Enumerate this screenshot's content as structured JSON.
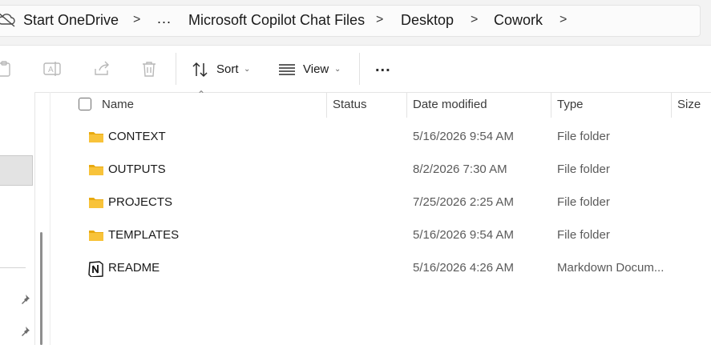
{
  "breadcrumb": {
    "items": [
      "Start OneDrive",
      "...",
      "Microsoft Copilot Chat Files",
      "Desktop",
      "Cowork"
    ],
    "separator": ">"
  },
  "toolbar": {
    "sort_label": "Sort",
    "view_label": "View",
    "more_label": "..."
  },
  "file_list": {
    "columns": {
      "name": "Name",
      "status": "Status",
      "date_modified": "Date modified",
      "type": "Type",
      "size": "Size"
    },
    "rows": [
      {
        "name": "CONTEXT",
        "date": "5/16/2026 9:54 AM",
        "type": "File folder",
        "icon": "folder-icon"
      },
      {
        "name": "OUTPUTS",
        "date": "8/2/2026 7:30 AM",
        "type": "File folder",
        "icon": "folder-icon"
      },
      {
        "name": "PROJECTS",
        "date": "7/25/2026 2:25 AM",
        "type": "File folder",
        "icon": "folder-icon"
      },
      {
        "name": "TEMPLATES",
        "date": "5/16/2026 9:54 AM",
        "type": "File folder",
        "icon": "folder-icon"
      },
      {
        "name": "README",
        "date": "5/16/2026 4:26 AM",
        "type": "Markdown Docum...",
        "icon": "notion-file-icon"
      }
    ]
  },
  "colors": {
    "folder": "#f8c33a",
    "folder_dark": "#e8a90f",
    "toolbar_bg": "#ffffff",
    "breadcrumb_bg": "#f3f3f3",
    "selected_nav": "#e3e3e3"
  }
}
